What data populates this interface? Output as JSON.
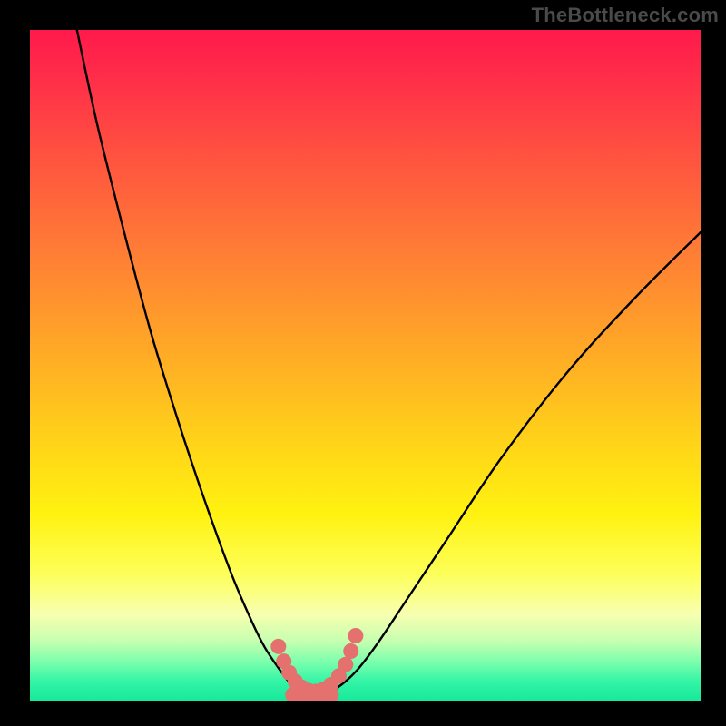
{
  "watermark": "TheBottleneck.com",
  "chart_data": {
    "type": "line",
    "title": "",
    "xlabel": "",
    "ylabel": "",
    "xlim": [
      0,
      100
    ],
    "ylim": [
      0,
      100
    ],
    "grid": false,
    "background_gradient": [
      {
        "stop": 0,
        "color": "#ff1a4b"
      },
      {
        "stop": 72,
        "color": "#fff210"
      },
      {
        "stop": 100,
        "color": "#16e89a"
      }
    ],
    "series": [
      {
        "name": "left-curve",
        "stroke": "#000000",
        "x": [
          7,
          10,
          14,
          18,
          22,
          26,
          30,
          33,
          35,
          37,
          38.5,
          40
        ],
        "y": [
          100,
          86,
          70,
          55,
          42,
          30,
          19,
          12,
          8,
          5,
          3,
          1.5
        ]
      },
      {
        "name": "right-curve",
        "stroke": "#000000",
        "x": [
          45,
          47,
          49,
          52,
          56,
          62,
          70,
          80,
          90,
          100
        ],
        "y": [
          1.5,
          3,
          5,
          9,
          15,
          24,
          36,
          49,
          60,
          70
        ]
      },
      {
        "name": "valley-markers",
        "type": "scatter",
        "color": "#e4716e",
        "x": [
          37.0,
          37.8,
          38.6,
          39.5,
          40.5,
          41.5,
          42.6,
          43.7,
          44.8,
          46.0,
          47.0,
          47.8,
          48.5
        ],
        "y": [
          8.2,
          6.0,
          4.3,
          3.0,
          2.1,
          1.6,
          1.5,
          1.8,
          2.5,
          3.8,
          5.5,
          7.5,
          9.8
        ]
      }
    ],
    "valley_bar": {
      "color": "#e4716e",
      "x_start": 38.0,
      "x_end": 46.0,
      "y": 1.0,
      "thickness_pct": 2.3
    }
  }
}
